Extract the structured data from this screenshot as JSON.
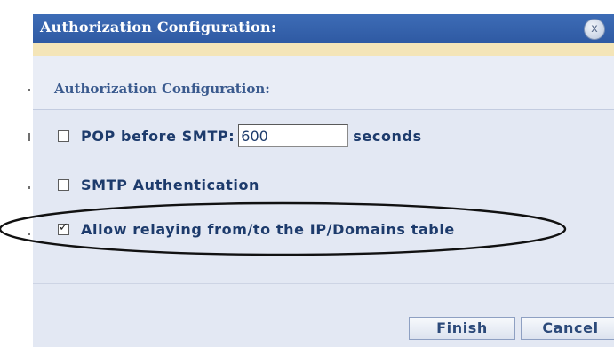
{
  "dialog": {
    "title": "Authorization Configuration:",
    "close_icon": "close-icon",
    "close_glyph": "x"
  },
  "panel": {
    "heading": "Authorization Configuration:"
  },
  "options": {
    "pop_before_smtp": {
      "label": "POP before SMTP:",
      "checked": false,
      "value": "600",
      "unit": "seconds"
    },
    "smtp_auth": {
      "label": "SMTP Authentication",
      "checked": false
    },
    "allow_relaying": {
      "label": "Allow relaying from/to the IP/Domains table",
      "checked": true,
      "tick_glyph": "✓"
    }
  },
  "buttons": {
    "finish": "Finish",
    "cancel": "Cancel"
  },
  "colors": {
    "titlebar": "#2f5aa3",
    "dialog_bg": "#e3e8f3",
    "accent_strip": "#f4e5b8",
    "label_text": "#1d3b6c"
  }
}
